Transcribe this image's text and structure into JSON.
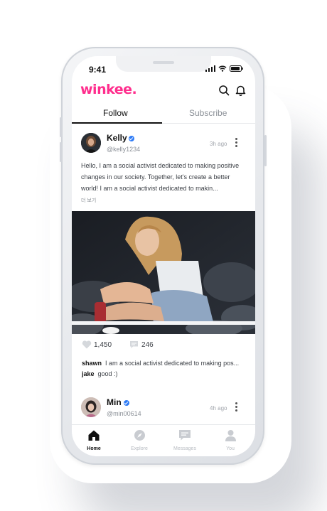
{
  "status": {
    "time": "9:41"
  },
  "app": {
    "logo": "winkee.",
    "brand_color": "#ff2e8d"
  },
  "header": {
    "icons": [
      "search-icon",
      "bell-icon"
    ]
  },
  "tabs": [
    {
      "label": "Follow",
      "active": true
    },
    {
      "label": "Subscribe",
      "active": false
    }
  ],
  "posts": [
    {
      "name": "Kelly",
      "handle": "@kelly1234",
      "time": "3h ago",
      "verified": true,
      "caption": "Hello, I am a social activist dedicated to making positive changes in our society. Together, let's create a better world! I am a social activist dedicated to makin...",
      "more": "더 보기",
      "likes": "1,450",
      "comments_count": "246",
      "comments": [
        {
          "user": "shawn",
          "text": "I am a social activist dedicated to making pos..."
        },
        {
          "user": "jake",
          "text": "good :)"
        }
      ]
    },
    {
      "name": "Min",
      "handle": "@min00614",
      "time": "4h ago",
      "verified": true
    }
  ],
  "nav": [
    {
      "label": "Home",
      "icon": "home-icon",
      "active": true
    },
    {
      "label": "Explore",
      "icon": "compass-icon",
      "active": false
    },
    {
      "label": "Messages",
      "icon": "message-icon",
      "active": false
    },
    {
      "label": "You",
      "icon": "user-icon",
      "active": false
    }
  ]
}
